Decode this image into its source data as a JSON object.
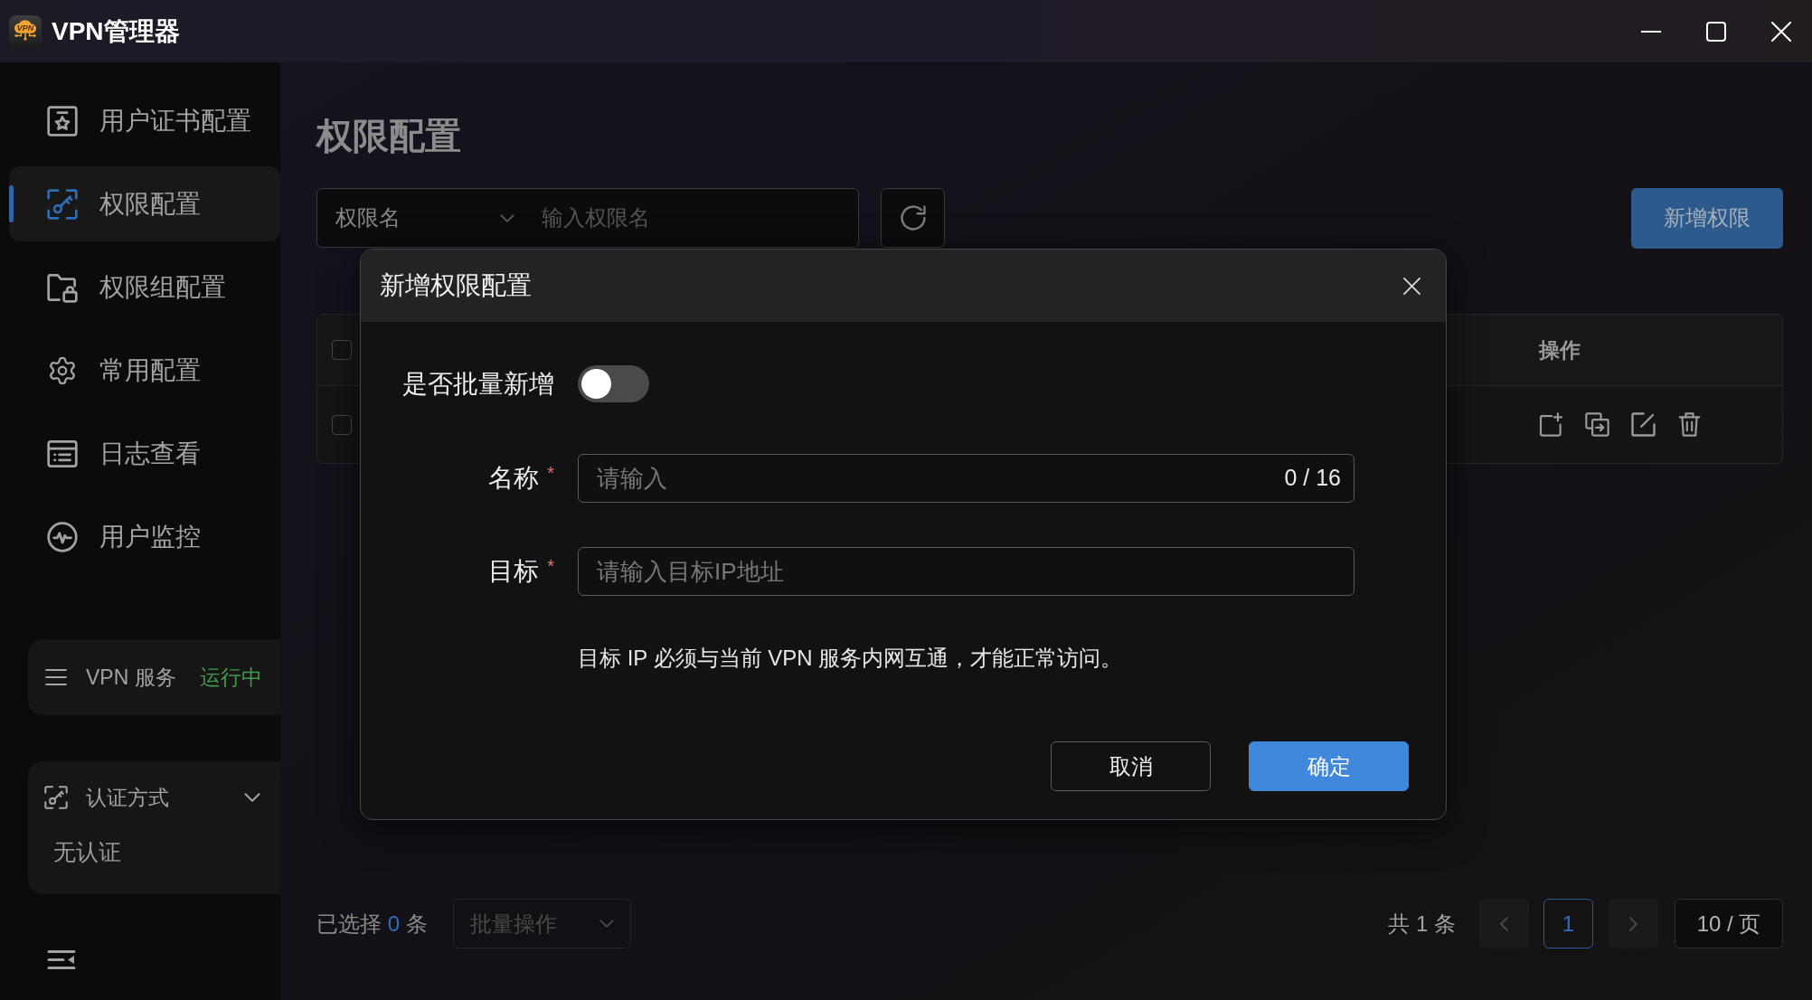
{
  "window": {
    "title": "VPN管理器",
    "logo_text": "VPN"
  },
  "sidebar": {
    "items": [
      {
        "label": "用户证书配置",
        "selected": false
      },
      {
        "label": "权限配置",
        "selected": true
      },
      {
        "label": "权限组配置",
        "selected": false
      },
      {
        "label": "常用配置",
        "selected": false
      },
      {
        "label": "日志查看",
        "selected": false
      },
      {
        "label": "用户监控",
        "selected": false
      }
    ],
    "service": {
      "label": "VPN 服务",
      "status": "运行中",
      "running": true
    },
    "auth": {
      "title": "认证方式",
      "expanded": true,
      "value": "无认证"
    }
  },
  "page": {
    "title": "权限配置",
    "search": {
      "field": "权限名",
      "placeholder": "输入权限名"
    },
    "add_button": "新增权限",
    "table": {
      "header_checked": false,
      "action_column": "操作",
      "rows": [
        {
          "checked": false
        }
      ]
    }
  },
  "footer": {
    "selection": {
      "prefix": "已选择 ",
      "count": "0",
      "suffix": " 条"
    },
    "batch": {
      "label": "批量操作",
      "disabled": true
    },
    "total": "共 1 条",
    "prev_disabled": true,
    "pages": [
      {
        "label": "1",
        "selected": true
      }
    ],
    "next_disabled": true,
    "page_size": "10 / 页"
  },
  "dialog": {
    "title": "新增权限配置",
    "batch": {
      "label": "是否批量新增",
      "on": false
    },
    "fields": [
      {
        "label": "名称",
        "required_mark": "*",
        "placeholder": "请输入",
        "counter": "0 / 16"
      },
      {
        "label": "目标",
        "required_mark": "*",
        "placeholder": "请输入目标IP地址"
      }
    ],
    "hint": "目标 IP 必须与当前 VPN 服务内网互通，才能正常访问。",
    "buttons": [
      {
        "label": "取消",
        "kind": "secondary"
      },
      {
        "label": "确定",
        "kind": "primary"
      }
    ]
  }
}
